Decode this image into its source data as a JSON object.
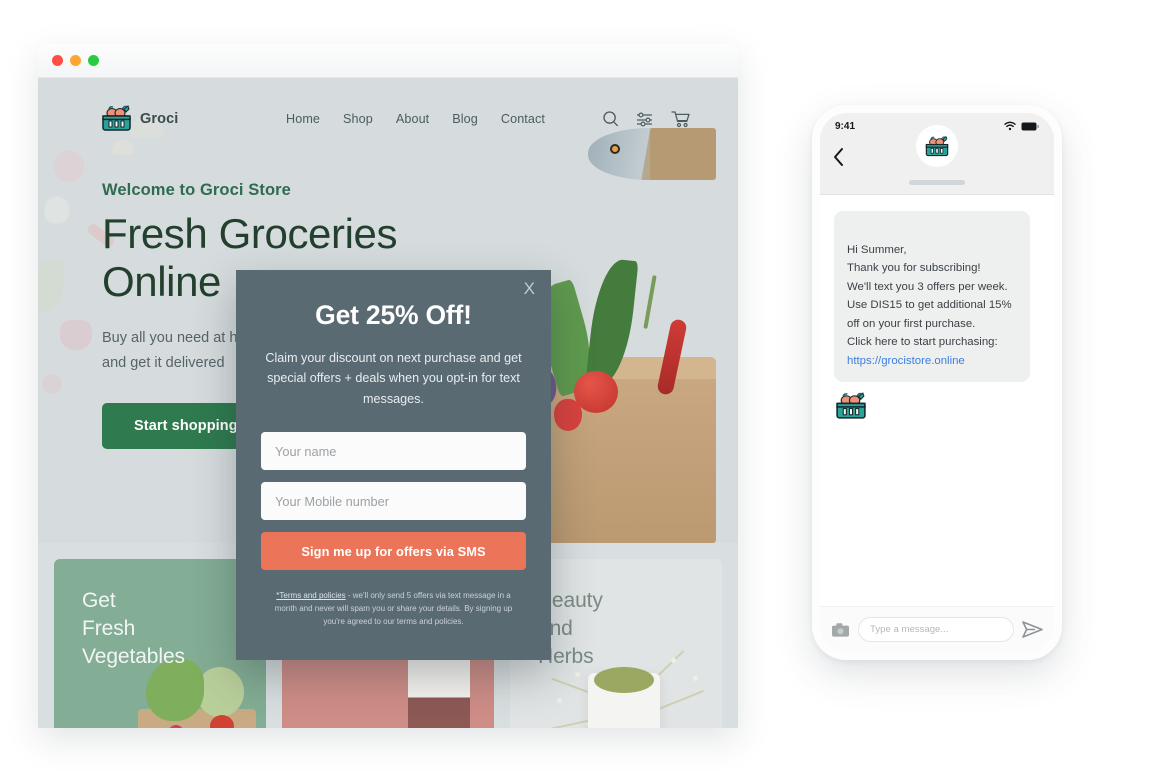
{
  "browser": {
    "traffic_lights": [
      "close-red",
      "minimize-yellow",
      "maximize-green"
    ]
  },
  "site": {
    "brand": "Groci",
    "nav_links": [
      "Home",
      "Shop",
      "About",
      "Blog",
      "Contact"
    ],
    "nav_icons": [
      "search-icon",
      "filter-icon",
      "cart-icon"
    ],
    "hero": {
      "eyebrow": "Welcome to Groci Store",
      "title": "Fresh Groceries Online",
      "subtitle": "Buy all you need at home\nand get it delivered",
      "cta": "Start shopping"
    },
    "cards": [
      {
        "title": "Get\nFresh\nVegetables",
        "color": "#83ad94"
      },
      {
        "title": "",
        "color": "#cf8d87"
      },
      {
        "title": "Beauty\nand\nHerbs",
        "color": "#e0e4e4"
      }
    ]
  },
  "modal": {
    "close_label": "X",
    "title": "Get 25% Off!",
    "description": "Claim your discount on next purchase and get special offers + deals when you opt-in for text messages.",
    "name_placeholder": "Your name",
    "phone_placeholder": "Your Mobile number",
    "submit_label": "Sign me up for offers via SMS",
    "terms_link": "*Terms and policies",
    "terms_text": " - we'll only send 5 offers via text message in a month and never will spam  you or share your details. By signing up you're agreed to our terms and policies.",
    "accent_color": "#ec7559",
    "panel_color": "#5a6a73"
  },
  "phone": {
    "status_time": "9:41",
    "status_icons": [
      "wifi-icon",
      "battery-icon"
    ],
    "back_icon": "back-chevron-icon",
    "avatar_icon": "groci-basket-icon",
    "message": "Hi Summer,\nThank you for subscribing!\nWe'll text you 3 offers per week. Use DIS15 to get additional 15% off on your first purchase.\nClick here to start purchasing:",
    "message_link": "https://grocistore.online",
    "input_placeholder": "Type a message...",
    "camera_icon": "camera-icon",
    "send_icon": "send-icon"
  }
}
